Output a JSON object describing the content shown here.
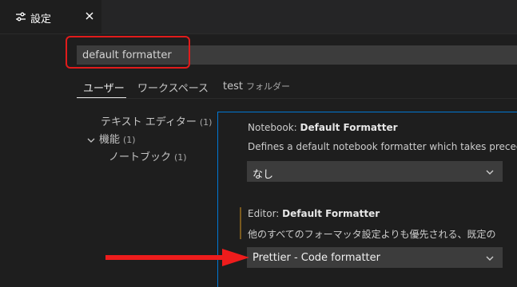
{
  "tab": {
    "icon": "settings-sliders-icon",
    "label": "設定",
    "close_icon": "close-icon"
  },
  "search": {
    "value": "default formatter"
  },
  "scopes": [
    {
      "label": "ユーザー",
      "active": true
    },
    {
      "label": "ワークスペース",
      "active": false
    },
    {
      "label": "test",
      "sub": "フォルダー",
      "active": false
    }
  ],
  "toc": {
    "text_editor": {
      "label": "テキスト エディター",
      "count": "(1)"
    },
    "features": {
      "label": "機能",
      "count": "(1)"
    },
    "notebook": {
      "label": "ノートブック",
      "count": "(1)"
    }
  },
  "settings": [
    {
      "category": "Notebook: ",
      "name": "Default Formatter",
      "description": "Defines a default notebook formatter which takes preceder",
      "value": "なし"
    },
    {
      "category": "Editor: ",
      "name": "Default Formatter",
      "description": "他のすべてのフォーマッタ設定よりも優先される、既定の",
      "value": "Prettier - Code formatter"
    }
  ],
  "colors": {
    "highlight": "#e11b1b",
    "accent": "#0078d4",
    "arrow": "#ee1c1c"
  }
}
